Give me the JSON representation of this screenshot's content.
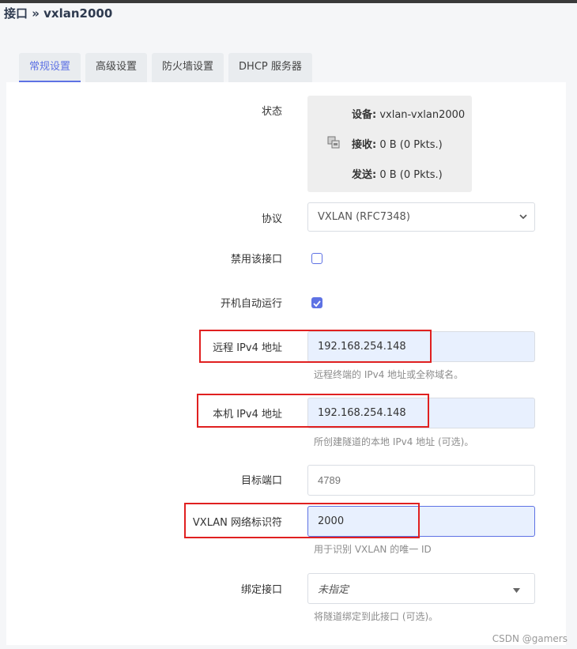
{
  "breadcrumb": "接口 » vxlan2000",
  "tabs": [
    {
      "label": "常规设置",
      "active": true
    },
    {
      "label": "高级设置",
      "active": false
    },
    {
      "label": "防火墙设置",
      "active": false
    },
    {
      "label": "DHCP 服务器",
      "active": false
    }
  ],
  "status": {
    "label": "状态",
    "device_label": "设备:",
    "device_value": "vxlan-vxlan2000",
    "rx_label": "接收:",
    "rx_value": "0 B (0 Pkts.)",
    "tx_label": "发送:",
    "tx_value": "0 B (0 Pkts.)",
    "icon": "network-port-icon"
  },
  "protocol": {
    "label": "协议",
    "value": "VXLAN (RFC7348)"
  },
  "disable": {
    "label": "禁用该接口",
    "checked": false
  },
  "autostart": {
    "label": "开机自动运行",
    "checked": true
  },
  "remote_ipv4": {
    "label": "远程 IPv4 地址",
    "value": "192.168.254.148",
    "help": "远程终端的 IPv4 地址或全称域名。"
  },
  "local_ipv4": {
    "label": "本机 IPv4 地址",
    "value": "192.168.254.148",
    "help": "所创建隧道的本地 IPv4 地址 (可选)。"
  },
  "target_port": {
    "label": "目标端口",
    "placeholder": "4789"
  },
  "vni": {
    "label": "VXLAN 网络标识符",
    "value": "2000",
    "help": "用于识别 VXLAN 的唯一 ID"
  },
  "bind_iface": {
    "label": "绑定接口",
    "value": "未指定",
    "help": "将隧道绑定到此接口 (可选)。"
  },
  "watermark": "CSDN @gamers",
  "colors": {
    "accent": "#5e72e4",
    "highlight": "#e02020",
    "autofill": "#e8f0fe"
  }
}
